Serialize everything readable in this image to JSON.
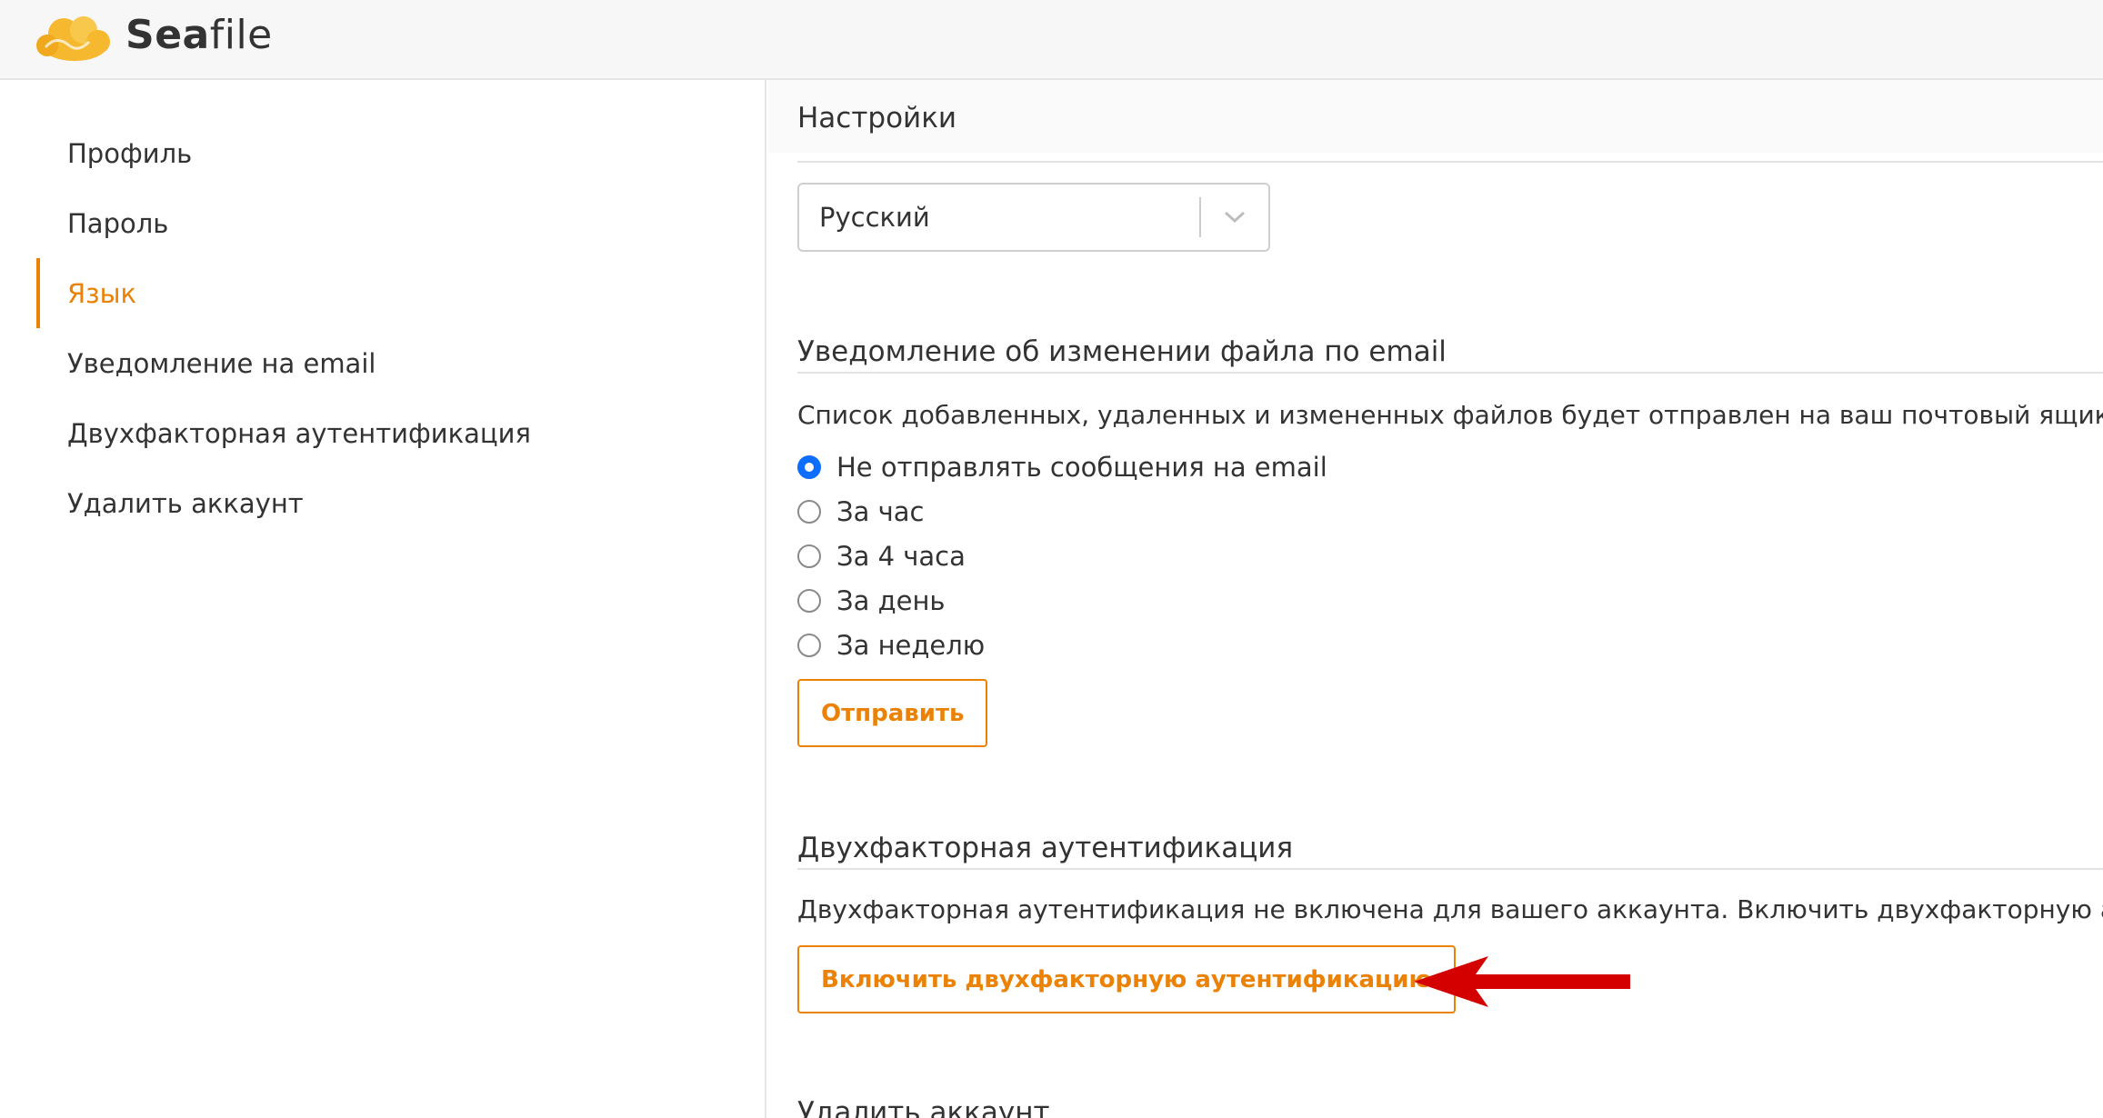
{
  "app": {
    "name_bold": "Sea",
    "name_rest": "file",
    "logo_icon": "seafile-cloud-icon"
  },
  "sidebar": {
    "items": [
      {
        "label": "Профиль",
        "active": false
      },
      {
        "label": "Пароль",
        "active": false
      },
      {
        "label": "Язык",
        "active": true
      },
      {
        "label": "Уведомление на email",
        "active": false
      },
      {
        "label": "Двухфакторная аутентификация",
        "active": false
      },
      {
        "label": "Удалить аккаунт",
        "active": false
      }
    ]
  },
  "main": {
    "title": "Настройки",
    "language": {
      "selected": "Русский",
      "icon": "chevron-down-icon"
    },
    "email_notification": {
      "title": "Уведомление об изменении файла по email",
      "description": "Список добавленных, удаленных и измененных файлов будет отправлен на ваш почтовый ящик.",
      "options": [
        {
          "label": "Не отправлять сообщения на email",
          "checked": true
        },
        {
          "label": "За час",
          "checked": false
        },
        {
          "label": "За 4 часа",
          "checked": false
        },
        {
          "label": "За день",
          "checked": false
        },
        {
          "label": "За неделю",
          "checked": false
        }
      ],
      "submit_label": "Отправить"
    },
    "two_factor": {
      "title": "Двухфакторная аутентификация",
      "description": "Двухфакторная аутентификация не включена для вашего аккаунта. Включить двухфакторную аутентифи",
      "enable_label": "Включить двухфакторную аутентификацию"
    },
    "delete_account": {
      "title": "Удалить аккаунт"
    }
  },
  "colors": {
    "accent": "#eb8205",
    "radio_checked": "#0d6efd",
    "annotation_arrow": "#d40000"
  }
}
